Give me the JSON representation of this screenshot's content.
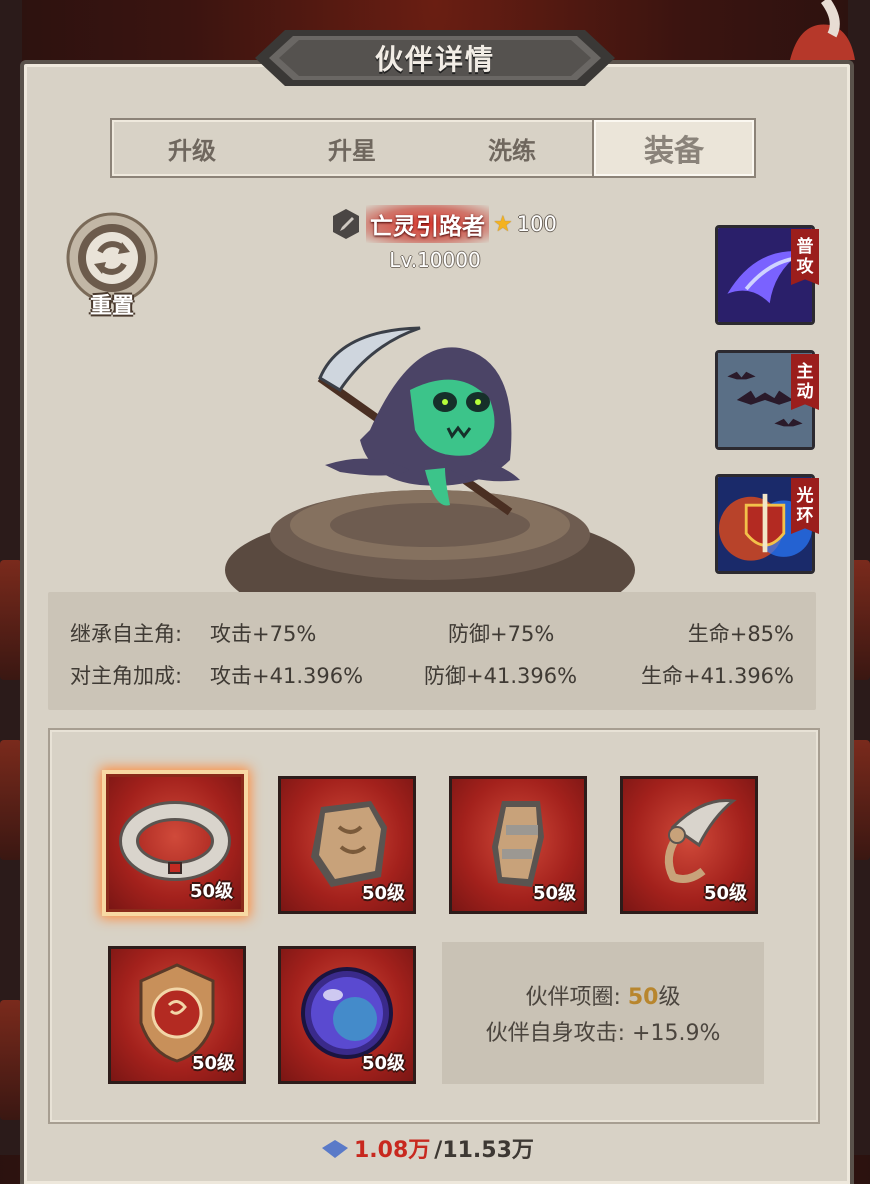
{
  "title": "伙伴详情",
  "tabs": [
    {
      "label": "升级",
      "active": false
    },
    {
      "label": "升星",
      "active": false
    },
    {
      "label": "洗练",
      "active": false
    },
    {
      "label": "装备",
      "active": true
    }
  ],
  "reset": {
    "label": "重置",
    "icon": "refresh-icon"
  },
  "hero": {
    "name": "亡灵引路者",
    "stars": "100",
    "level": "Lv.10000",
    "class_icon": "sword-class-icon"
  },
  "skills": [
    {
      "tag": [
        "普",
        "攻"
      ],
      "type": "basic-attack",
      "icon": "ghost-slash-icon"
    },
    {
      "tag": [
        "主",
        "动"
      ],
      "type": "active",
      "icon": "bat-swarm-icon"
    },
    {
      "tag": [
        "光",
        "环"
      ],
      "type": "aura",
      "icon": "shield-sword-icon"
    }
  ],
  "stats": {
    "inherit": {
      "label": "继承自主角:",
      "attack": "攻击+75%",
      "defense": "防御+75%",
      "hp": "生命+85%"
    },
    "bonus": {
      "label": "对主角加成:",
      "attack": "攻击+41.396%",
      "defense": "防御+41.396%",
      "hp": "生命+41.396%"
    }
  },
  "equipment": [
    {
      "name": "ring",
      "icon": "ring-icon",
      "level": "50级",
      "selected": true
    },
    {
      "name": "armor",
      "icon": "armor-icon",
      "level": "50级",
      "selected": false
    },
    {
      "name": "gauntlet",
      "icon": "gauntlet-icon",
      "level": "50级",
      "selected": false
    },
    {
      "name": "weapon",
      "icon": "scythe-weapon-icon",
      "level": "50级",
      "selected": false
    },
    {
      "name": "emblem",
      "icon": "emblem-icon",
      "level": "50级",
      "selected": false
    },
    {
      "name": "orb",
      "icon": "orb-icon",
      "level": "50级",
      "selected": false
    }
  ],
  "selected_info": {
    "line1_prefix": "伙伴项圈: ",
    "line1_value": "50",
    "line1_suffix": "级",
    "line2": "伙伴自身攻击: +15.9%"
  },
  "bottom": {
    "current": "1.08万",
    "max": "/11.53万"
  },
  "colors": {
    "panel": "#d8d2c6",
    "slot_red": "#a3211c",
    "gold": "#b8862e",
    "tag_red": "#9b1e1c"
  }
}
